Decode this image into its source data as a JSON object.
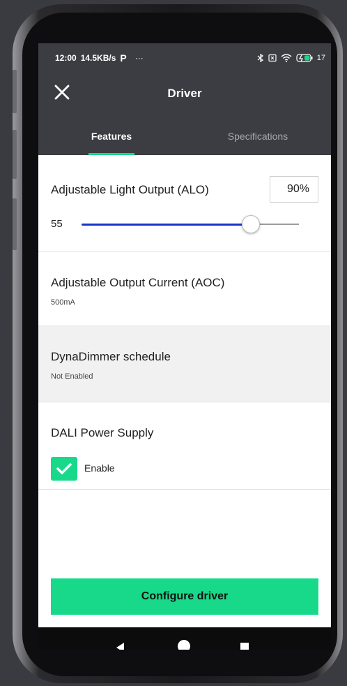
{
  "status_bar": {
    "time": "12:00",
    "speed": "14.5KB/s",
    "p_symbol": "P",
    "dots": "···",
    "battery": "17"
  },
  "header": {
    "title": "Driver",
    "close_icon": "close-icon"
  },
  "tabs": [
    {
      "label": "Features",
      "active": true
    },
    {
      "label": "Specifications",
      "active": false
    }
  ],
  "alo": {
    "title": "Adjustable Light Output (ALO)",
    "percent": "90%",
    "value": "55",
    "slider_fraction": 0.78
  },
  "aoc": {
    "title": "Adjustable Output Current (AOC)",
    "value": "500mA"
  },
  "dynadimmer": {
    "title": "DynaDimmer schedule",
    "status": "Not Enabled"
  },
  "dali": {
    "title": "DALI Power Supply",
    "checkbox_label": "Enable",
    "checked": true
  },
  "cta": {
    "label": "Configure driver"
  },
  "colors": {
    "accent": "#18d98a",
    "header_bg": "#3c3d42",
    "slider_blue": "#1a33c8"
  }
}
